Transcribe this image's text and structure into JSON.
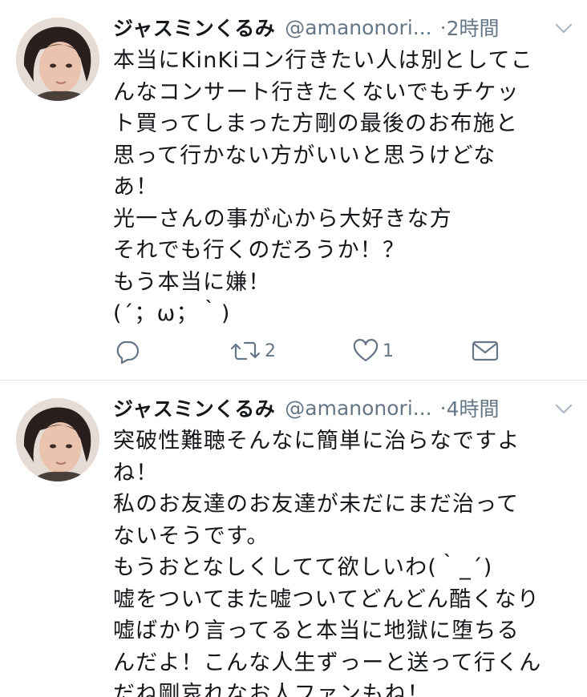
{
  "tweets": [
    {
      "name": "ジャスミンくるみ",
      "handle": "@amanonori...",
      "dot": "·",
      "time": "2時間",
      "lines": [
        "本当にKinKiコン行きたい人は別としてこ",
        "んなコンサート行きたくないでもチケッ",
        "ト買ってしまった方剛の最後のお布施と",
        "思って行かない方がいいと思うけどな",
        "あ！",
        "光一さんの事が心から大好きな方",
        "それでも行くのだろうか！？",
        "もう本当に嫌！",
        "(´；ω；｀)"
      ],
      "retweets": "2",
      "likes": "1"
    },
    {
      "name": "ジャスミンくるみ",
      "handle": "@amanonori...",
      "dot": "·",
      "time": "4時間",
      "lines": [
        "突破性難聴そんなに簡単に治らなですよ",
        "ね！",
        "私のお友達のお友達が未だにまだ治って",
        "ないそうです。",
        "もうおとなしくしてて欲しいわ(｀_´)",
        "嘘をついてまた嘘ついてどんどん酷くなり",
        "嘘ばかり言ってると本当に地獄に堕ちる",
        "んだよ！こんな人生ずっーと送って行くん",
        "だね剛哀れなお人ファンもね！"
      ]
    }
  ],
  "icons": {
    "reply": "reply-icon",
    "retweet": "retweet-icon",
    "like": "heart-icon",
    "dm": "envelope-icon",
    "menu": "chevron-down-icon"
  },
  "colors": {
    "text": "#14171a",
    "secondary": "#657786",
    "divider": "#e1e8ed"
  }
}
